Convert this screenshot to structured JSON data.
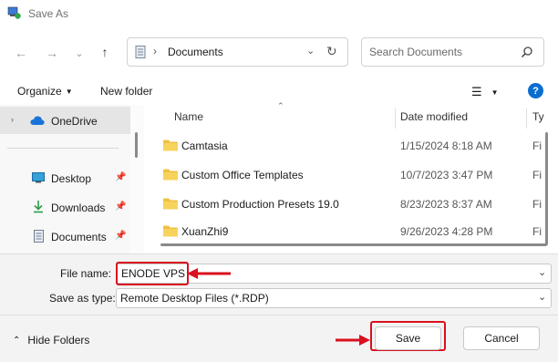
{
  "window": {
    "title": "Save As"
  },
  "navigation": {
    "address_path": "Documents",
    "search_placeholder": "Search Documents"
  },
  "toolbar": {
    "organize_label": "Organize",
    "new_folder_label": "New folder"
  },
  "nav_pane": {
    "items": [
      {
        "label": "OneDrive",
        "icon": "cloud-icon"
      },
      {
        "label": "Desktop",
        "icon": "desktop-icon"
      },
      {
        "label": "Downloads",
        "icon": "download-icon"
      },
      {
        "label": "Documents",
        "icon": "document-icon"
      }
    ]
  },
  "file_list": {
    "columns": {
      "name": "Name",
      "date_modified": "Date modified",
      "type": "Ty"
    },
    "rows": [
      {
        "name": "Camtasia",
        "date": "1/15/2024 8:18 AM",
        "type": "Fi"
      },
      {
        "name": "Custom Office Templates",
        "date": "10/7/2023 3:47 PM",
        "type": "Fi"
      },
      {
        "name": "Custom Production Presets 19.0",
        "date": "8/23/2023 8:37 AM",
        "type": "Fi"
      },
      {
        "name": "XuanZhi9",
        "date": "9/26/2023 4:28 PM",
        "type": "Fi"
      }
    ]
  },
  "form": {
    "file_name_label": "File name:",
    "file_name_value": "ENODE VPS",
    "save_type_label": "Save as type:",
    "save_type_value": "Remote Desktop Files (*.RDP)"
  },
  "footer": {
    "hide_folders_label": "Hide Folders",
    "save_label": "Save",
    "cancel_label": "Cancel"
  },
  "colors": {
    "annotation_red": "#d9101e",
    "folder_yellow": "#f0c040",
    "help_blue": "#0a6ed1"
  }
}
